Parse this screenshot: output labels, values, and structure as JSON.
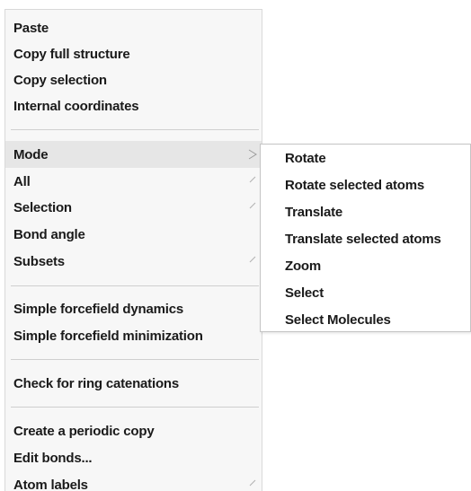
{
  "menu": {
    "groups": [
      [
        "Paste",
        "Copy full structure",
        "Copy selection",
        "Internal coordinates"
      ],
      [
        "Mode",
        "All",
        "Selection",
        "Bond angle",
        "Subsets"
      ],
      [
        "Simple forcefield dynamics",
        "Simple forcefield minimization"
      ],
      [
        "Check for ring catenations"
      ],
      [
        "Create a periodic copy",
        "Edit bonds...",
        "Atom labels"
      ]
    ],
    "items": {
      "paste": "Paste",
      "copy_full_structure": "Copy full structure",
      "copy_selection": "Copy selection",
      "internal_coordinates": "Internal coordinates",
      "mode": "Mode",
      "all": "All",
      "selection": "Selection",
      "bond_angle": "Bond angle",
      "subsets": "Subsets",
      "simple_forcefield_dynamics": "Simple forcefield dynamics",
      "simple_forcefield_minimization": "Simple forcefield minimization",
      "check_ring_catenations": "Check for ring catenations",
      "create_periodic_copy": "Create a periodic copy",
      "edit_bonds": "Edit bonds...",
      "atom_labels": "Atom labels"
    },
    "active_item": "Mode",
    "submenu_arrow_icon": "submenu-arrow-icon"
  },
  "submenu": {
    "parent": "Mode",
    "items": {
      "rotate": "Rotate",
      "rotate_selected_atoms": "Rotate selected atoms",
      "translate": "Translate",
      "translate_selected_atoms": "Translate selected atoms",
      "zoom": "Zoom",
      "select": "Select",
      "select_molecules": "Select Molecules"
    }
  },
  "colors": {
    "menu_background": "#f7f7f7",
    "active_background": "#e6e6e6",
    "submenu_background": "#ffffff",
    "text": "#1a1a1a",
    "separator": "#cfcfcf"
  }
}
